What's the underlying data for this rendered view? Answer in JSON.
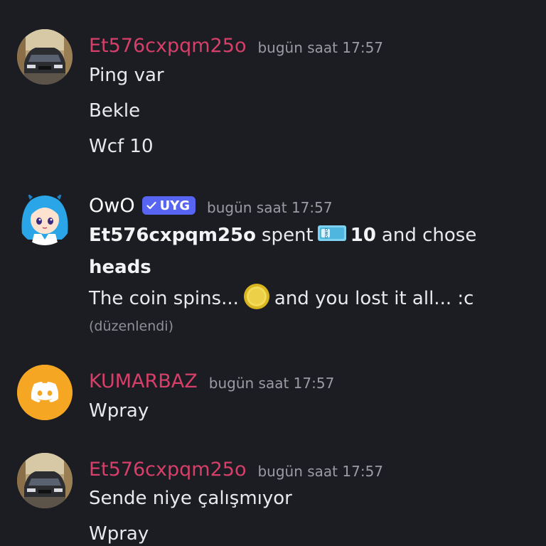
{
  "messages": [
    {
      "username": "Et576cxpqm25o",
      "timestamp": "bugün saat 17:57",
      "lines": [
        "Ping var",
        "Bekle",
        "Wcf 10"
      ]
    },
    {
      "username": "OwO",
      "badge": "UYG",
      "timestamp": "bugün saat 17:57",
      "line1": {
        "user": "Et576cxpqm25o",
        "spent": "spent",
        "amount": "10",
        "chose": "and chose"
      },
      "line2": "heads",
      "line3": {
        "before": "The coin spins...",
        "after": "and you lost it all... :c"
      },
      "edited": "(düzenlendi)"
    },
    {
      "username": "KUMARBAZ",
      "timestamp": "bugün saat 17:57",
      "lines": [
        "Wpray"
      ]
    },
    {
      "username": "Et576cxpqm25o",
      "timestamp": "bugün saat 17:57",
      "lines": [
        "Sende niye çalışmıyor",
        "Wpray"
      ]
    }
  ],
  "colors": {
    "background": "#1c1d22",
    "username_pink": "#d63f6a",
    "badge_blue": "#5865f2",
    "discord_avatar_orange": "#f5a623"
  },
  "icons": {
    "car_avatar": "car-photo-avatar",
    "owo_avatar": "anime-girl-avatar",
    "discord_avatar": "discord-logo-icon",
    "cowoncy": "cowoncy-bill-icon",
    "coin": "gold-coin-icon",
    "checkmark": "checkmark-icon"
  }
}
